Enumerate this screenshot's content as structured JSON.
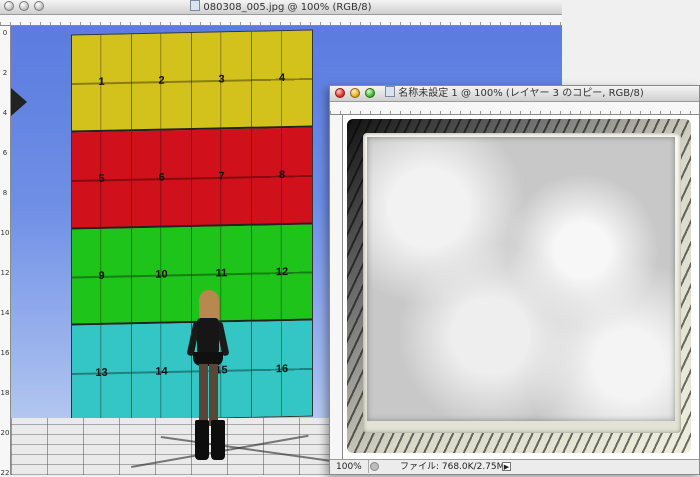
{
  "window1": {
    "title": "080308_005.jpg @ 100% (RGB/8)",
    "ruler_left_labels": [
      "0",
      "2",
      "4",
      "6",
      "8",
      "10",
      "12",
      "14",
      "16",
      "18",
      "20",
      "22"
    ],
    "wall_rows": [
      {
        "color": "#d4c21c",
        "cells": [
          "1",
          "2",
          "3",
          "4"
        ]
      },
      {
        "color": "#d0101a",
        "cells": [
          "5",
          "6",
          "7",
          "8"
        ]
      },
      {
        "color": "#1fc41a",
        "cells": [
          "9",
          "10",
          "11",
          "12"
        ]
      },
      {
        "color": "#33c6c4",
        "cells": [
          "13",
          "14",
          "15",
          "16"
        ]
      }
    ]
  },
  "window2": {
    "title": "名称未設定 1 @ 100% (レイヤー 3 のコピー, RGB/8)",
    "status": {
      "zoom": "100%",
      "file_info": "ファイル: 768.0K/2.75M",
      "arrow": "▶"
    }
  }
}
